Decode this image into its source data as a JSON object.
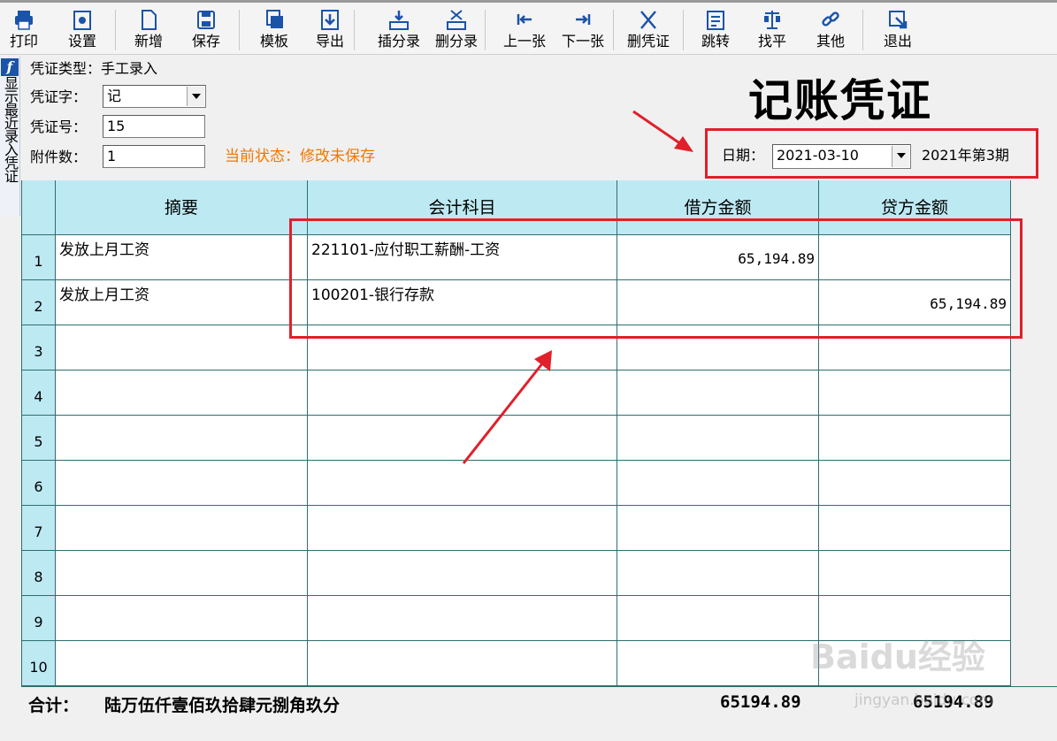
{
  "toolbar": {
    "items": [
      {
        "label": "打印",
        "icon": "printer-icon"
      },
      {
        "label": "设置",
        "icon": "settings-icon"
      },
      {
        "label": "新增",
        "icon": "new-file-icon"
      },
      {
        "label": "保存",
        "icon": "save-icon"
      },
      {
        "label": "模板",
        "icon": "template-icon"
      },
      {
        "label": "导出",
        "icon": "export-icon"
      },
      {
        "label": "插分录",
        "icon": "insert-row-icon"
      },
      {
        "label": "删分录",
        "icon": "delete-row-icon"
      },
      {
        "label": "上一张",
        "icon": "previous-icon"
      },
      {
        "label": "下一张",
        "icon": "next-icon"
      },
      {
        "label": "删凭证",
        "icon": "delete-voucher-icon"
      },
      {
        "label": "跳转",
        "icon": "jump-icon"
      },
      {
        "label": "找平",
        "icon": "balance-icon"
      },
      {
        "label": "其他",
        "icon": "link-icon"
      },
      {
        "label": "退出",
        "icon": "exit-icon"
      }
    ]
  },
  "side_tab": {
    "letter": "f",
    "text": "显示最近录入凭证"
  },
  "header": {
    "voucher_type_label": "凭证类型：手工录入",
    "voucher_word_label": "凭证字：",
    "voucher_word_value": "记",
    "voucher_no_label": "凭证号：",
    "voucher_no_value": "15",
    "attachments_label": "附件数：",
    "attachments_value": "1",
    "status": "当前状态：修改未保存",
    "title": "记账凭证",
    "date_label": "日期：",
    "date_value": "2021-03-10",
    "period": "2021年第3期"
  },
  "grid": {
    "columns": [
      "摘要",
      "会计科目",
      "借方金额",
      "贷方金额"
    ],
    "rows": [
      {
        "no": "1",
        "summary": "发放上月工资",
        "account": "221101-应付职工薪酬-工资",
        "debit": "65,194.89",
        "credit": ""
      },
      {
        "no": "2",
        "summary": "发放上月工资",
        "account": "100201-银行存款",
        "debit": "",
        "credit": "65,194.89"
      },
      {
        "no": "3",
        "summary": "",
        "account": "",
        "debit": "",
        "credit": ""
      },
      {
        "no": "4",
        "summary": "",
        "account": "",
        "debit": "",
        "credit": ""
      },
      {
        "no": "5",
        "summary": "",
        "account": "",
        "debit": "",
        "credit": ""
      },
      {
        "no": "6",
        "summary": "",
        "account": "",
        "debit": "",
        "credit": ""
      },
      {
        "no": "7",
        "summary": "",
        "account": "",
        "debit": "",
        "credit": ""
      },
      {
        "no": "8",
        "summary": "",
        "account": "",
        "debit": "",
        "credit": ""
      },
      {
        "no": "9",
        "summary": "",
        "account": "",
        "debit": "",
        "credit": ""
      },
      {
        "no": "10",
        "summary": "",
        "account": "",
        "debit": "",
        "credit": ""
      }
    ]
  },
  "totals": {
    "label": "合计：",
    "words": "陆万伍仟壹佰玖拾肆元捌角玖分",
    "debit": "65194.89",
    "credit": "65194.89"
  },
  "watermark": {
    "brand": "Baidu经验",
    "url": "jingyan.baidu.com"
  },
  "colors": {
    "grid_header": "#bde9f3",
    "grid_line": "#2e6e6e",
    "status": "#f07800",
    "annotation_red": "#e0202a"
  }
}
